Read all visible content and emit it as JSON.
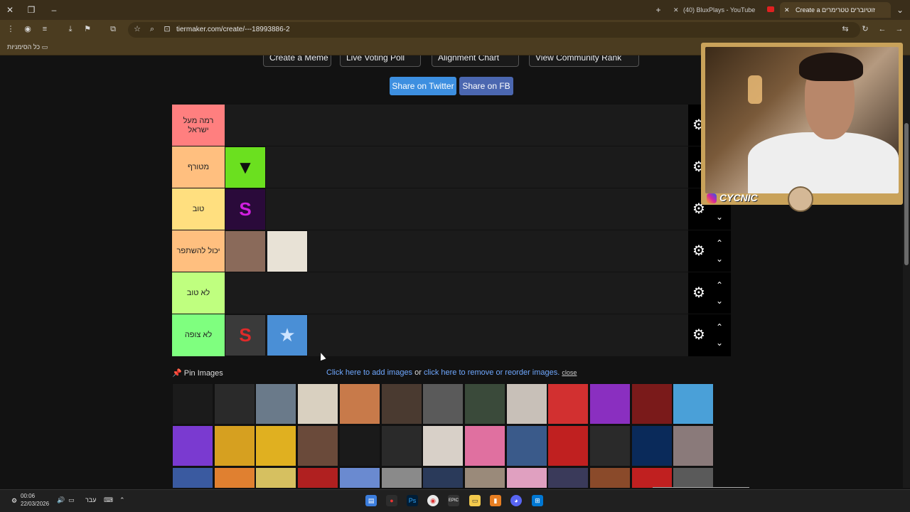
{
  "browser": {
    "tabs": [
      {
        "label": "(40) BluxPlays - YouTube",
        "active": false
      },
      {
        "label": "Create a זוטיוברים טטרימרים",
        "active": true
      }
    ],
    "url": "tiermaker.com/create/---18993886-2",
    "bookmarks_label": "כל הסימניות"
  },
  "page": {
    "top_buttons": [
      "Create a Meme",
      "Live Voting Poll",
      "Alignment Chart",
      "View Community Rank"
    ],
    "share_twitter": "Share on Twitter",
    "share_fb": "Share on FB",
    "tiers": [
      {
        "label": "רמה מעל ישראל",
        "color": "#ff7f7f",
        "item_count": 0,
        "has_arrows": false
      },
      {
        "label": "מטורף",
        "color": "#ffbf7f",
        "item_count": 1,
        "has_arrows": false
      },
      {
        "label": "טוב",
        "color": "#ffdf7f",
        "item_count": 1,
        "has_arrows": true
      },
      {
        "label": "יכול להשתפר",
        "color": "#ffbf7f",
        "item_count": 2,
        "has_arrows": true
      },
      {
        "label": "לא טוב",
        "color": "#bfff7f",
        "item_count": 0,
        "has_arrows": true
      },
      {
        "label": "לא צופה",
        "color": "#7fff7f",
        "item_count": 2,
        "has_arrows": true
      }
    ],
    "pin_images": "Pin Images",
    "add_link": "Click here to add images",
    "or_text": "or",
    "remove_link": "click here to remove or reorder images.",
    "close_link": "close"
  },
  "overlay": {
    "streamer_name": "CYCNIC"
  },
  "taskbar": {
    "time": "00:06",
    "date": "22/03/2026",
    "lang": "עבר"
  },
  "colors": {
    "twitter": "#3d8fe0",
    "fb": "#4b67b0",
    "link": "#6fa8ff"
  }
}
